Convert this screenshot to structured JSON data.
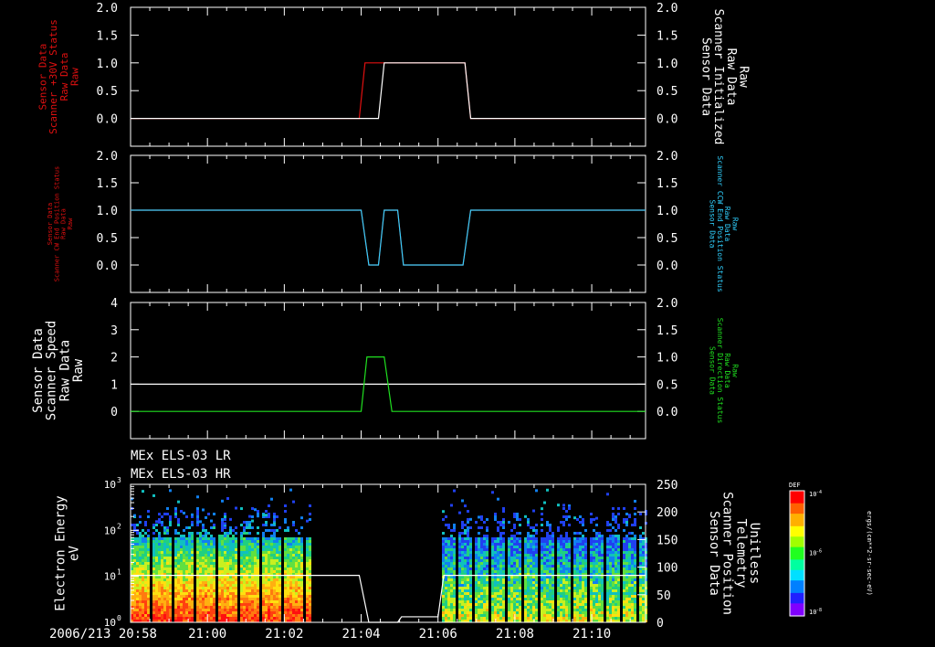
{
  "colors": {
    "background": "#000000",
    "axes": "#ffffff",
    "red": "#e01010",
    "cyan": "#30d0ff",
    "green": "#20e020",
    "white": "#ffffff"
  },
  "x_axis": {
    "range_minutes": [
      0,
      13.4
    ],
    "tick_labels": [
      "2006/213 20:58",
      "21:00",
      "21:02",
      "21:04",
      "21:06",
      "21:08",
      "21:10"
    ],
    "tick_minutes": [
      0,
      2,
      4,
      6,
      8,
      10,
      12
    ]
  },
  "chart_data": [
    {
      "type": "line",
      "panel": "scanner-30v-status",
      "left_axis": {
        "label_lines": [
          "Sensor Data",
          "Scanner +30V Status",
          "Raw Data",
          "Raw"
        ],
        "label_color": "red",
        "ylim": [
          -0.5,
          2.0
        ],
        "ticks": [
          0.0,
          0.5,
          1.0,
          1.5,
          2.0
        ],
        "tick_labels": [
          "0.0",
          "0.5",
          "1.0",
          "1.5",
          "2.0"
        ]
      },
      "right_axis": {
        "label_lines": [
          "Sensor Data",
          "Scanner Initialized",
          "Raw Data",
          "Raw"
        ],
        "label_color": "white",
        "ylim": [
          -0.5,
          2.0
        ],
        "ticks": [
          0.0,
          0.5,
          1.0,
          1.5,
          2.0
        ],
        "tick_labels": [
          "0.0",
          "0.5",
          "1.0",
          "1.5",
          "2.0"
        ]
      },
      "series": [
        {
          "color": "red",
          "x": [
            0,
            5.95,
            6.1,
            6.45,
            8.7,
            8.85,
            13.4
          ],
          "y": [
            0,
            0,
            1,
            1,
            1,
            0,
            0
          ]
        },
        {
          "color": "white",
          "x": [
            0,
            6.45,
            6.6,
            8.7,
            8.85,
            13.4
          ],
          "y": [
            0,
            0,
            1,
            1,
            0,
            0
          ]
        }
      ]
    },
    {
      "type": "line",
      "panel": "scanner-ccw-end-position-status",
      "left_axis": {
        "label_lines": [
          "Sensor Data",
          "Scanner CW End Position Status",
          "Raw Data",
          "Raw"
        ],
        "label_color": "red",
        "ylim": [
          -0.5,
          2.0
        ],
        "ticks": [
          0.0,
          0.5,
          1.0,
          1.5,
          2.0
        ],
        "tick_labels": [
          "0.0",
          "0.5",
          "1.0",
          "1.5",
          "2.0"
        ]
      },
      "right_axis": {
        "label_lines": [
          "Sensor Data",
          "Scanner CCW End Position Status",
          "Raw Data",
          "Raw"
        ],
        "label_color": "cyan",
        "ylim": [
          -0.5,
          2.0
        ],
        "ticks": [
          0.0,
          0.5,
          1.0,
          1.5,
          2.0
        ],
        "tick_labels": [
          "0.0",
          "0.5",
          "1.0",
          "1.5",
          "2.0"
        ]
      },
      "series": [
        {
          "color": "red",
          "x": [
            0,
            6.0,
            6.2,
            6.45,
            6.6,
            6.95,
            7.1,
            8.65,
            8.85,
            13.4
          ],
          "y": [
            1,
            1,
            0,
            0,
            1,
            1,
            0,
            0,
            1,
            1
          ]
        },
        {
          "color": "cyan",
          "x": [
            0,
            6.0,
            6.2,
            6.45,
            6.6,
            6.95,
            7.1,
            8.65,
            8.85,
            13.4
          ],
          "y": [
            1,
            1,
            0,
            0,
            1,
            1,
            0,
            0,
            1,
            1
          ]
        }
      ]
    },
    {
      "type": "line",
      "panel": "scanner-speed-direction",
      "left_axis": {
        "label_lines": [
          "Sensor Data",
          "Scanner Speed",
          "Raw Data",
          "Raw"
        ],
        "label_color": "white",
        "ylim": [
          -1,
          4
        ],
        "ticks": [
          0,
          1,
          2,
          3,
          4
        ],
        "tick_labels": [
          "0",
          "1",
          "2",
          "3",
          "4"
        ]
      },
      "right_axis": {
        "label_lines": [
          "Sensor Data",
          "Scanner Direction Status",
          "Raw Data",
          "Raw"
        ],
        "label_color": "green",
        "ylim": [
          -0.5,
          2.0
        ],
        "ticks": [
          0.0,
          0.5,
          1.0,
          1.5,
          2.0
        ],
        "tick_labels": [
          "0.0",
          "0.5",
          "1.0",
          "1.5",
          "2.0"
        ]
      },
      "series": [
        {
          "color": "white",
          "axis": "left",
          "x": [
            0,
            13.4
          ],
          "y": [
            1,
            1
          ]
        },
        {
          "color": "green",
          "axis": "right",
          "x": [
            0,
            6.0,
            6.15,
            6.6,
            6.8,
            13.4
          ],
          "y": [
            0,
            0,
            1,
            1,
            0,
            0
          ]
        }
      ]
    },
    {
      "type": "heatmap",
      "panel": "els-spectrogram",
      "titles": [
        "MEx ELS-03 LR",
        "MEx ELS-03 HR"
      ],
      "left_axis": {
        "label_lines": [
          "Electron Energy",
          "eV"
        ],
        "label_color": "white",
        "scale": "log",
        "ylim": [
          1,
          1000
        ],
        "tick_exponents": [
          0,
          1,
          2,
          3
        ]
      },
      "right_axis": {
        "label_lines": [
          "Sensor Data",
          "Scanner Position",
          "Telemetry",
          "Unitless"
        ],
        "label_color": "white",
        "ylim": [
          0,
          250
        ],
        "ticks": [
          0,
          50,
          100,
          150,
          200,
          250
        ],
        "tick_labels": [
          "0",
          "50",
          "100",
          "150",
          "200",
          "250"
        ]
      },
      "data_intervals_minutes": [
        [
          0,
          4.7
        ],
        [
          8.1,
          13.4
        ]
      ],
      "overlay_series": {
        "color": "white",
        "x": [
          0,
          5.95,
          6.2,
          6.95,
          7.05,
          8.0,
          8.15,
          13.4
        ],
        "y": [
          85,
          85,
          0,
          0,
          10,
          10,
          85,
          85
        ]
      },
      "colorbar": {
        "title": "DEF",
        "tick_labels": [
          "10",
          "10",
          "10"
        ],
        "tick_exponents": [
          "-4",
          "-6",
          "-8"
        ],
        "units": "ergs/(cm**2-sr-sec-eV)"
      }
    }
  ]
}
